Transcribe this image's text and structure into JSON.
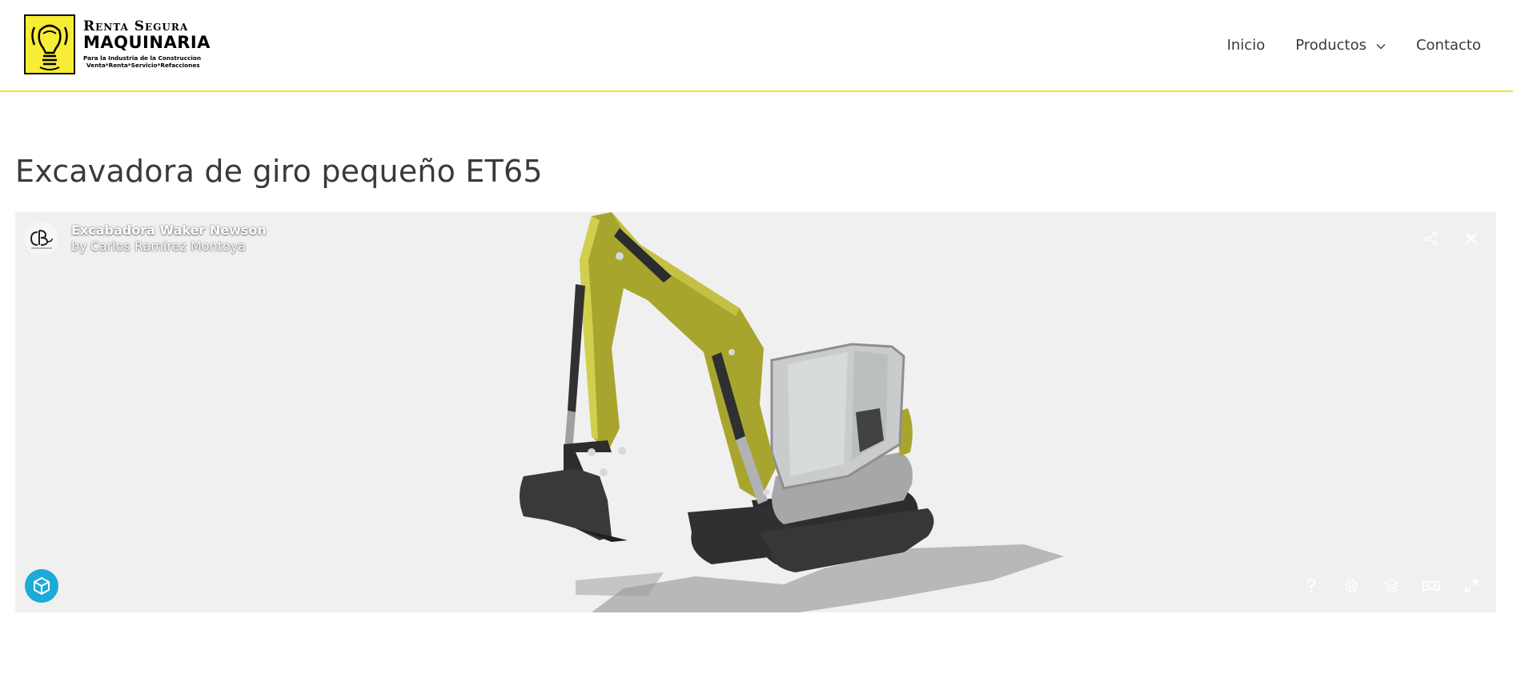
{
  "brand": {
    "line1": "Renta Segura",
    "line2": "MAQUINARIA",
    "line3": "Para la Industria de la Construccion",
    "line4": "Venta*Renta*Servicio*Refacciones",
    "accent_color": "#f7ec36"
  },
  "nav": {
    "items": [
      {
        "label": "Inicio"
      },
      {
        "label": "Productos",
        "icon": "chevron-down-icon"
      },
      {
        "label": "Contacto"
      }
    ]
  },
  "page": {
    "title": "Excavadora de giro pequeño ET65"
  },
  "viewer": {
    "model_title": "Excabadora Waker Newson",
    "author_prefix": "by",
    "author_name": "Carlos Ramirez Montoya",
    "top_tools": [
      "share-icon",
      "close-icon"
    ],
    "bottom_tools": [
      "help-icon",
      "settings-icon",
      "layers-icon",
      "vr-icon",
      "fullscreen-icon"
    ],
    "badge": "sketchfab-logo-icon",
    "badge_color": "#1caad9",
    "background": "#f0f0f0",
    "model_color": "#a8a52e"
  }
}
